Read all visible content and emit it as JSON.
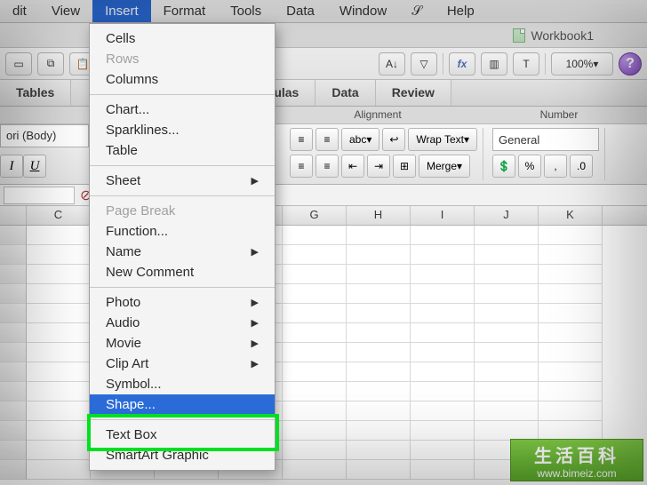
{
  "menubar": {
    "items": [
      "dit",
      "View",
      "Insert",
      "Format",
      "Tools",
      "Data",
      "Window",
      "",
      "Help"
    ],
    "active_index": 2
  },
  "workbook": {
    "title": "Workbook1"
  },
  "toolbar": {
    "zoom": "100%",
    "help_glyph": "?"
  },
  "ribbon_tabs": [
    "Tables",
    "ulas",
    "Data",
    "Review"
  ],
  "ribbon_groups": {
    "alignment": "Alignment",
    "number": "Number"
  },
  "alignment": {
    "wrap": "Wrap Text",
    "merge": "Merge",
    "abc": "abc"
  },
  "number": {
    "format": "General"
  },
  "font": {
    "name_fragment": "ori (Body)",
    "italic": "I",
    "underline": "U"
  },
  "formula": {
    "fx": "fx"
  },
  "columns": [
    "",
    "C",
    "",
    "",
    "",
    "G",
    "H",
    "I",
    "J",
    "K"
  ],
  "dropdown": {
    "sections": [
      [
        {
          "label": "Cells",
          "disabled": false,
          "sub": false
        },
        {
          "label": "Rows",
          "disabled": true,
          "sub": false
        },
        {
          "label": "Columns",
          "disabled": false,
          "sub": false
        }
      ],
      [
        {
          "label": "Chart...",
          "disabled": false,
          "sub": false
        },
        {
          "label": "Sparklines...",
          "disabled": false,
          "sub": false
        },
        {
          "label": "Table",
          "disabled": false,
          "sub": false
        }
      ],
      [
        {
          "label": "Sheet",
          "disabled": false,
          "sub": true
        }
      ],
      [
        {
          "label": "Page Break",
          "disabled": true,
          "sub": false
        },
        {
          "label": "Function...",
          "disabled": false,
          "sub": false
        },
        {
          "label": "Name",
          "disabled": false,
          "sub": true
        },
        {
          "label": "New Comment",
          "disabled": false,
          "sub": false
        }
      ],
      [
        {
          "label": "Photo",
          "disabled": false,
          "sub": true
        },
        {
          "label": "Audio",
          "disabled": false,
          "sub": true
        },
        {
          "label": "Movie",
          "disabled": false,
          "sub": true
        },
        {
          "label": "Clip Art",
          "disabled": false,
          "sub": true
        },
        {
          "label": "Symbol...",
          "disabled": false,
          "sub": false
        },
        {
          "label": "Shape...",
          "disabled": false,
          "sub": false,
          "selected": true
        }
      ],
      [
        {
          "label": "Text Box",
          "disabled": false,
          "sub": false
        },
        {
          "label": "SmartArt Graphic",
          "disabled": false,
          "sub": false
        }
      ]
    ]
  },
  "watermark": {
    "zh": "生活百科",
    "url": "www.bimeiz.com"
  }
}
